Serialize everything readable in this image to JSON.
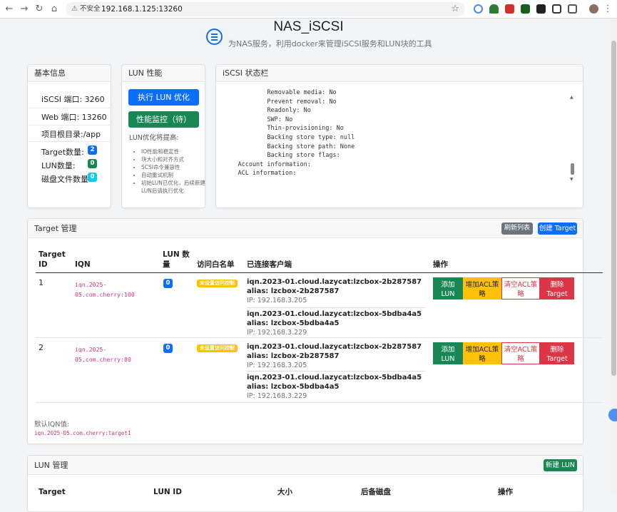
{
  "browser": {
    "security_label": "不安全",
    "url": "192.168.1.125:13260"
  },
  "header": {
    "title": "NAS_iSCSI",
    "subtitle": "为NAS服务，利用docker来管理iSCSI服务和LUN块的工具"
  },
  "basic_info": {
    "title": "基本信息",
    "iscsi_port": "iSCSI 端口: 3260",
    "web_port": "Web 端口: 13260",
    "root_dir": "项目根目录:/app",
    "target_label": "Target数量:",
    "target_count": "2",
    "lun_label": "LUN数量:",
    "lun_count": "0",
    "disk_label": "磁盘文件数量:",
    "disk_count": "0"
  },
  "lun_perf": {
    "title": "LUN 性能",
    "optimize_button": "执行 LUN 优化",
    "monitor_button": "性能监控（待）",
    "note": "LUN优化将提高:",
    "items": [
      "IO性能和稳定性",
      "块大小和对齐方式",
      "SCSI命令兼容性",
      "自动重试机制",
      "初始LUN已优化，后续新建LUN后请执行优化"
    ]
  },
  "iscsi_status": {
    "title": "iSCSI 状态栏",
    "lines": [
      "            Removable media: No",
      "            Prevent removal: No",
      "            Readonly: No",
      "            SWP: No",
      "            Thin-provisioning: No",
      "            Backing store type: null",
      "            Backing store path: None",
      "            Backing store flags:",
      "    Account information:",
      "    ACL information:"
    ]
  },
  "target_mgmt": {
    "title": "Target 管理",
    "refresh_button": "刷新列表",
    "create_button": "创建 Target",
    "columns": {
      "id": "Target ID",
      "iqn": "IQN",
      "lun_count": "LUN 数量",
      "whitelist": "访问白名单",
      "clients": "已连接客户端",
      "actions": "操作"
    },
    "rows": [
      {
        "id": "1",
        "iqn": "iqn.2025-05.com.cherry:100",
        "lun": "0",
        "whitelist": "未设置访问控制",
        "clients": [
          {
            "name": "iqn.2023-01.cloud.lazycat:lzcbox-2b287587 alias: lzcbox-2b287587",
            "ip": "IP: 192.168.3.205"
          },
          {
            "name": "iqn.2023-01.cloud.lazycat:lzcbox-5bdba4a5 alias: lzcbox-5bdba4a5",
            "ip": "IP: 192.168.3.229"
          }
        ]
      },
      {
        "id": "2",
        "iqn": "iqn.2025-05.com.cherry:80",
        "lun": "0",
        "whitelist": "未设置访问控制",
        "clients": [
          {
            "name": "iqn.2023-01.cloud.lazycat:lzcbox-2b287587 alias: lzcbox-2b287587",
            "ip": "IP: 192.168.3.205"
          },
          {
            "name": "iqn.2023-01.cloud.lazycat:lzcbox-5bdba4a5 alias: lzcbox-5bdba4a5",
            "ip": "IP: 192.168.3.229"
          }
        ]
      }
    ],
    "actions": {
      "add_lun": "添加 LUN",
      "add_acl": "增加ACL策略",
      "clear_acl": "清空ACL策略",
      "delete": "删除 Target"
    },
    "default_iqn_label": "默认IQN值:",
    "default_iqn": "iqn.2025-05.com.cherry:target1"
  },
  "lun_mgmt": {
    "title": "LUN 管理",
    "create_button": "新建 LUN",
    "columns": {
      "target_id": "Target",
      "lun_id": "LUN ID",
      "size": "大小",
      "backing": "后备磁盘",
      "actions": "操作"
    }
  },
  "colors": {
    "primary": "#0d6efd",
    "success": "#198754",
    "warning": "#ffc107",
    "danger": "#dc3545",
    "secondary": "#6c757d",
    "info": "#0dcaf0"
  }
}
